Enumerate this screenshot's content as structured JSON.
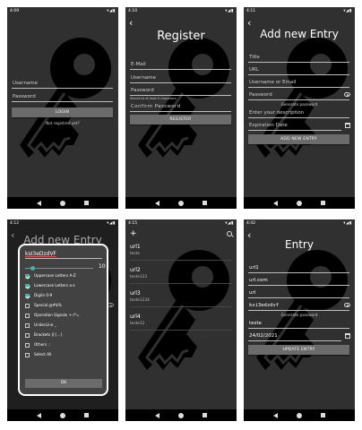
{
  "screens": {
    "login": {
      "time": "4:09",
      "username_placeholder": "Username",
      "password_placeholder": "Password",
      "login_label": "LOGIN",
      "register_link": "Not registred yet?"
    },
    "register": {
      "time": "4:10",
      "title": "Register",
      "email_placeholder": "E-Mail",
      "username_placeholder": "Username",
      "password_placeholder": "Password",
      "password_hint": "Should be at least 8 characters",
      "confirm_placeholder": "Confirm Password",
      "register_label": "REGISTER"
    },
    "add_entry": {
      "time": "4:11",
      "title": "Add new Entry",
      "title_placeholder": "Title",
      "url_placeholder": "URL",
      "user_placeholder": "Username or Email",
      "password_placeholder": "Password",
      "generate_label": "Generate password",
      "description_placeholder": "Enter your description",
      "expiration_placeholder": "Expiration Date",
      "add_label": "ADD NEW ENTRY"
    },
    "generator": {
      "time": "4:12",
      "behind_title": "Add new Entry",
      "password_value": "ksI3eDzdVF",
      "length_value": "10",
      "length_fraction": 0.1,
      "options": [
        {
          "label": "Uppercase Letters A-Z",
          "checked": true
        },
        {
          "label": "Lowercase Letters a-z",
          "checked": true
        },
        {
          "label": "Digits 0-9",
          "checked": true
        },
        {
          "label": "Special @#$%",
          "checked": false
        },
        {
          "label": "Operation Signals +-/*=",
          "checked": false
        },
        {
          "label": "UnderLine _",
          "checked": false
        },
        {
          "label": "Brackets ([{...}",
          "checked": false
        },
        {
          "label": "Others .:",
          "checked": false
        },
        {
          "label": "Select All",
          "checked": false
        }
      ],
      "ok_label": "OK"
    },
    "list": {
      "time": "4:15",
      "add_glyph": "+",
      "items": [
        {
          "title": "url1",
          "subtitle": "teste"
        },
        {
          "title": "url2",
          "subtitle": "teste123"
        },
        {
          "title": "url3",
          "subtitle": "teste1234"
        },
        {
          "title": "url4",
          "subtitle": "teste12"
        }
      ]
    },
    "entry": {
      "time": "4:42",
      "title": "Entry",
      "title_value": "url1",
      "url_value": "url.com",
      "user_value": "url",
      "password_value": "ksi3edzdvf",
      "generate_label": "Generate password",
      "description_value": "teste",
      "date_value": "24/02/2021",
      "update_label": "UPDATE ENTRY"
    }
  },
  "status_icons": "▾◢▮",
  "colors": {
    "background": "#303030",
    "button": "#6b6b6b",
    "accent": "#4caf9f"
  },
  "icons": [
    "key-logo-icon",
    "back-arrow-icon",
    "eye-icon",
    "calendar-icon",
    "search-icon",
    "plus-icon",
    "checkbox-icon"
  ]
}
